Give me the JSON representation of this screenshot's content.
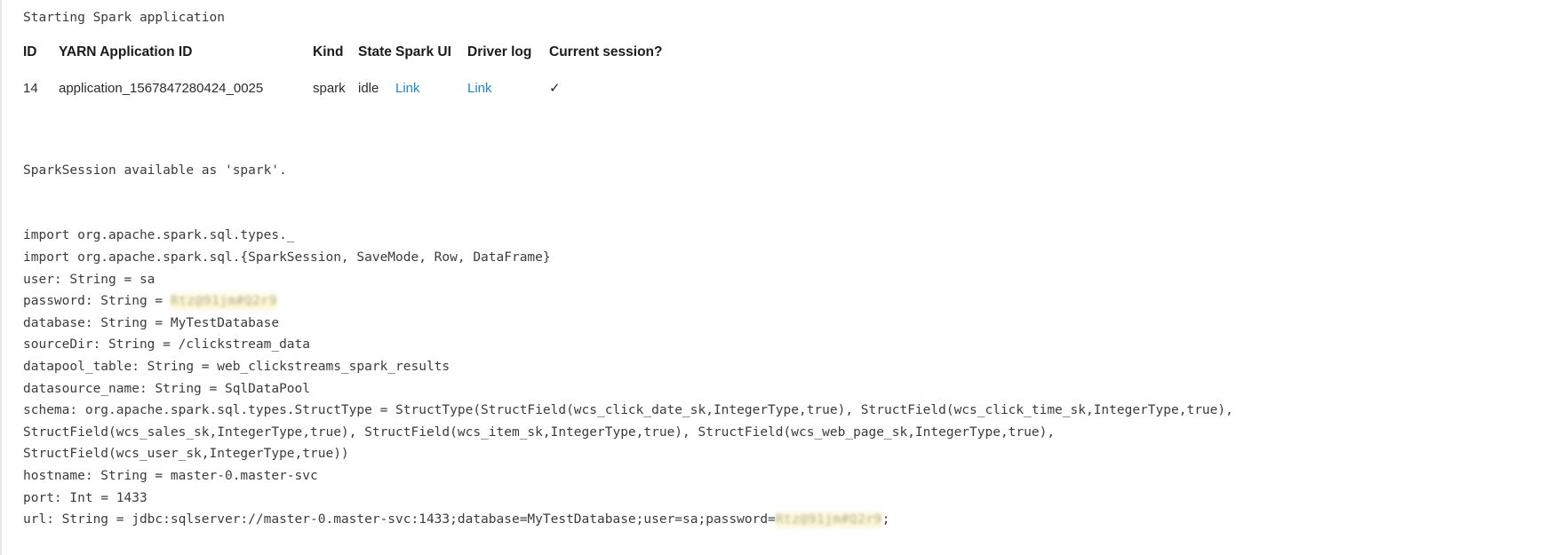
{
  "status": {
    "message": "Starting Spark application"
  },
  "session_table": {
    "columns": [
      "ID",
      "YARN Application ID",
      "Kind",
      "State",
      "Spark UI",
      "Driver log",
      "Current session?"
    ],
    "rows": [
      {
        "id": "14",
        "yarn_application_id": "application_1567847280424_0025",
        "kind": "spark",
        "state": "idle",
        "spark_ui": "Link",
        "driver_log": "Link",
        "current_session": "✓"
      }
    ],
    "link_color": "#1f87c7"
  },
  "output": {
    "lines": [
      {
        "text": ""
      },
      {
        "text": "SparkSession available as 'spark'."
      },
      {
        "text": ""
      },
      {
        "text": ""
      },
      {
        "text": "import org.apache.spark.sql.types._"
      },
      {
        "text": "import org.apache.spark.sql.{SparkSession, SaveMode, Row, DataFrame}"
      },
      {
        "text": "user: String = sa"
      },
      {
        "text": "password: String = ",
        "redacted": "Rtz@91jm#Q2r9"
      },
      {
        "text": "database: String = MyTestDatabase"
      },
      {
        "text": "sourceDir: String = /clickstream_data"
      },
      {
        "text": "datapool_table: String = web_clickstreams_spark_results"
      },
      {
        "text": "datasource_name: String = SqlDataPool"
      },
      {
        "text": "schema: org.apache.spark.sql.types.StructType = StructType(StructField(wcs_click_date_sk,IntegerType,true), StructField(wcs_click_time_sk,IntegerType,true),"
      },
      {
        "text": "StructField(wcs_sales_sk,IntegerType,true), StructField(wcs_item_sk,IntegerType,true), StructField(wcs_web_page_sk,IntegerType,true),"
      },
      {
        "text": "StructField(wcs_user_sk,IntegerType,true))"
      },
      {
        "text": "hostname: String = master-0.master-svc"
      },
      {
        "text": "port: Int = 1433"
      },
      {
        "text": "url: String = jdbc:sqlserver://master-0.master-svc:1433;database=MyTestDatabase;user=sa;password=",
        "redacted": "Rtz@91jm#Q2r9",
        "suffix": ";"
      }
    ]
  }
}
